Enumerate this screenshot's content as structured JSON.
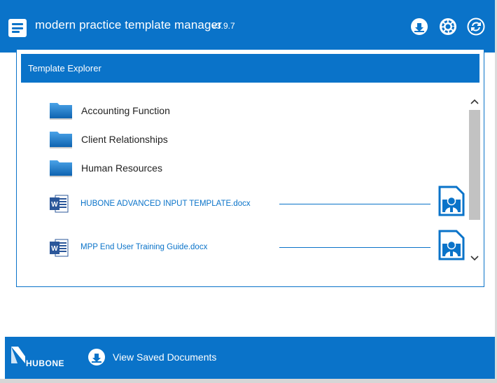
{
  "header": {
    "title": "modern practice template manager",
    "version": "v3.9.7",
    "icons": [
      "menu-icon",
      "download-icon",
      "settings-icon",
      "refresh-icon"
    ]
  },
  "explorer": {
    "title": "Template Explorer",
    "folders": [
      {
        "label": "Accounting Function"
      },
      {
        "label": "Client Relationships"
      },
      {
        "label": "Human Resources"
      }
    ],
    "documents": [
      {
        "label": "HUBONE ADVANCED INPUT TEMPLATE.docx"
      },
      {
        "label": "MPP End User Training Guide.docx"
      }
    ]
  },
  "footer": {
    "brand": "HubOne",
    "view_saved_label": "View Saved Documents"
  },
  "colors": {
    "accent": "#0a73c9",
    "folder": "#1d7fd0",
    "word": "#2b579a"
  }
}
